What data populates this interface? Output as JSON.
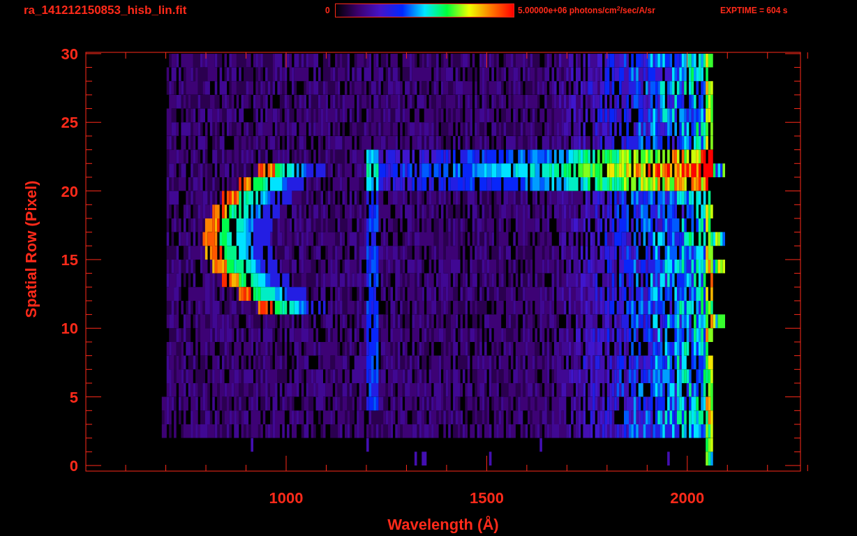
{
  "title": "ra_141212150853_hisb_lin.fit",
  "colorbar": {
    "min_label": "0",
    "max_label": "5.00000e+06 photons/cm$^{2}$/sec/A/sr"
  },
  "exposure": "EXPTIME = 604 s",
  "plot": {
    "y_axis": {
      "label": "Spatial Row (Pixel)",
      "ticks": [
        "30",
        "25",
        "20",
        "15",
        "10",
        "5",
        "0"
      ]
    },
    "x_axis": {
      "label": "Wavelength (Å)",
      "ticks": [
        "1000",
        "1500",
        "2000"
      ]
    }
  }
}
